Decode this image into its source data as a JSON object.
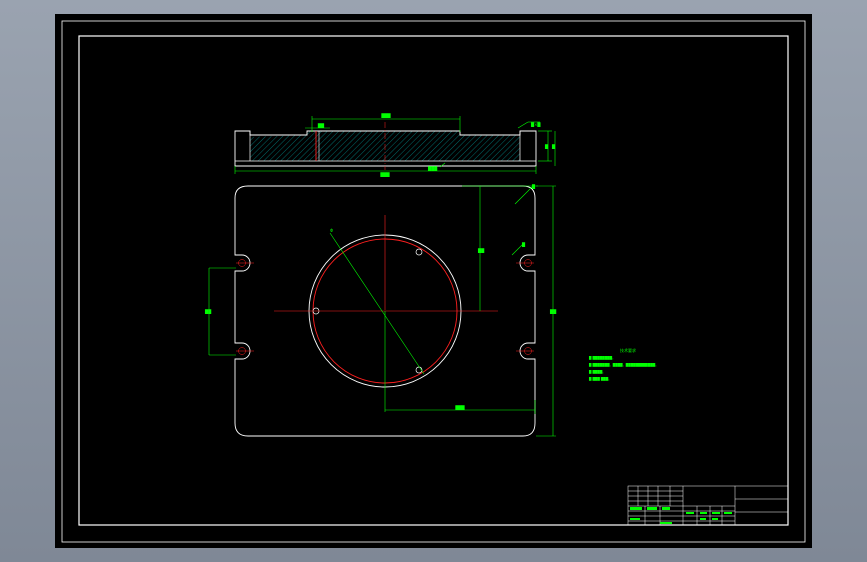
{
  "colors": {
    "background": "#000000",
    "frame": "#ffffff",
    "outline": "#ffffff",
    "dimension": "#00ff00",
    "center_line": "#ff0000",
    "hatch": "#00cccc",
    "note_text": "#00ff00",
    "titleblock": "#ffffff",
    "titleblock_text": "#00ff00"
  },
  "drawing": {
    "section_view": {
      "top_dimension": "███",
      "left_dimension": "██",
      "right_dimension_1": "█",
      "right_dimension_2": "█",
      "corner_label": "█×█",
      "bottom_dimension": "███",
      "surface_label": "███"
    },
    "plan_view": {
      "diameter_label": "Φ",
      "top_right_label": "█",
      "radius_label": "█",
      "vertical_dimension": "██",
      "slot_spacing": "██",
      "overall_height": "██",
      "bottom_dimension": "███"
    },
    "tech_requirements": {
      "title": "技术要求",
      "lines": [
        "█ ████████。",
        "█ ███████，████，████████████。",
        "█ ████。",
        "█ ███ ███。"
      ]
    }
  }
}
